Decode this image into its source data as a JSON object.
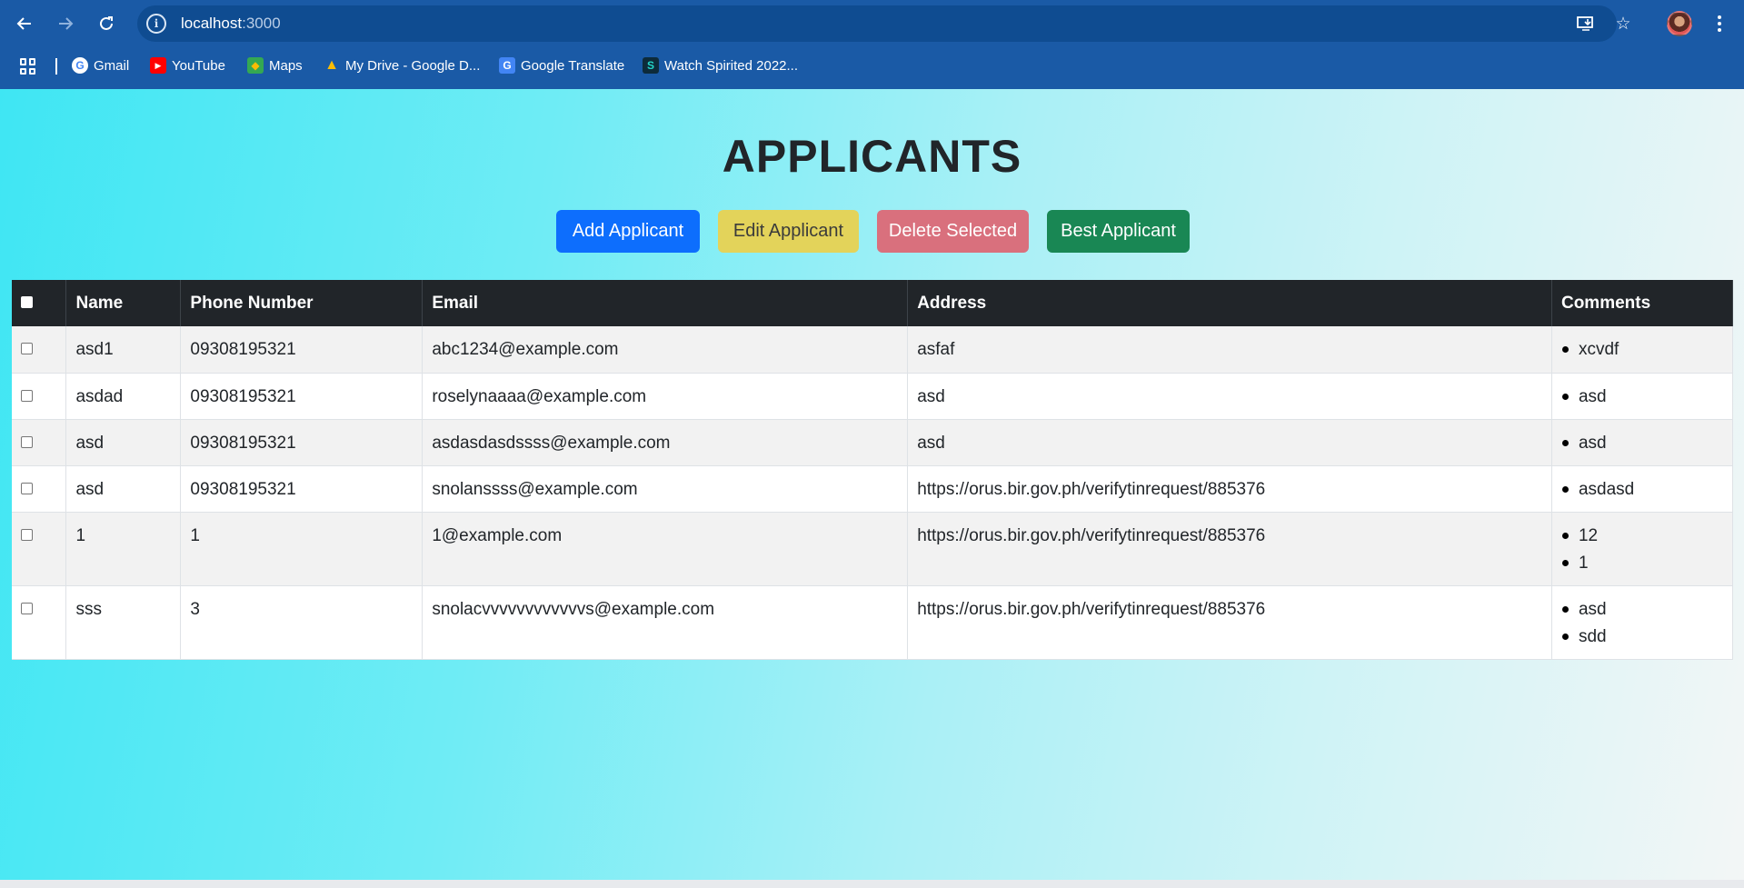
{
  "browser": {
    "url_host": "localhost",
    "url_port": ":3000",
    "bookmarks": [
      {
        "label": "Gmail",
        "icon": "google-icon"
      },
      {
        "label": "YouTube",
        "icon": "youtube-icon"
      },
      {
        "label": "Maps",
        "icon": "maps-icon"
      },
      {
        "label": "My Drive - Google D...",
        "icon": "drive-icon"
      },
      {
        "label": "Google Translate",
        "icon": "translate-icon"
      },
      {
        "label": "Watch Spirited 2022...",
        "icon": "spirited-icon"
      }
    ]
  },
  "page": {
    "title": "APPLICANTS",
    "buttons": {
      "add": "Add Applicant",
      "edit": "Edit Applicant",
      "delete": "Delete Selected",
      "best": "Best Applicant"
    }
  },
  "table": {
    "headers": [
      "Name",
      "Phone Number",
      "Email",
      "Address",
      "Comments"
    ],
    "rows": [
      {
        "name": "asd1",
        "phone": "09308195321",
        "email": "abc1234@example.com",
        "address": "asfaf",
        "comments": [
          "xcvdf"
        ]
      },
      {
        "name": "asdad",
        "phone": "09308195321",
        "email": "roselynaaaa@example.com",
        "address": "asd",
        "comments": [
          "asd"
        ]
      },
      {
        "name": "asd",
        "phone": "09308195321",
        "email": "asdasdasdssss@example.com",
        "address": "asd",
        "comments": [
          "asd"
        ]
      },
      {
        "name": "asd",
        "phone": "09308195321",
        "email": "snolanssss@example.com",
        "address": "https://orus.bir.gov.ph/verifytinrequest/885376",
        "comments": [
          "asdasd"
        ]
      },
      {
        "name": "1",
        "phone": "1",
        "email": "1@example.com",
        "address": "https://orus.bir.gov.ph/verifytinrequest/885376",
        "comments": [
          "12",
          "1"
        ]
      },
      {
        "name": "sss",
        "phone": "3",
        "email": "snolacvvvvvvvvvvvvs@example.com",
        "address": "https://orus.bir.gov.ph/verifytinrequest/885376",
        "comments": [
          "asd",
          "sdd"
        ]
      }
    ]
  },
  "colors": {
    "primary": "#0d6efd",
    "warning": "#e3d35a",
    "danger": "#d9707d",
    "success": "#198754",
    "table_header": "#212529",
    "chrome": "#1a5aa6"
  }
}
